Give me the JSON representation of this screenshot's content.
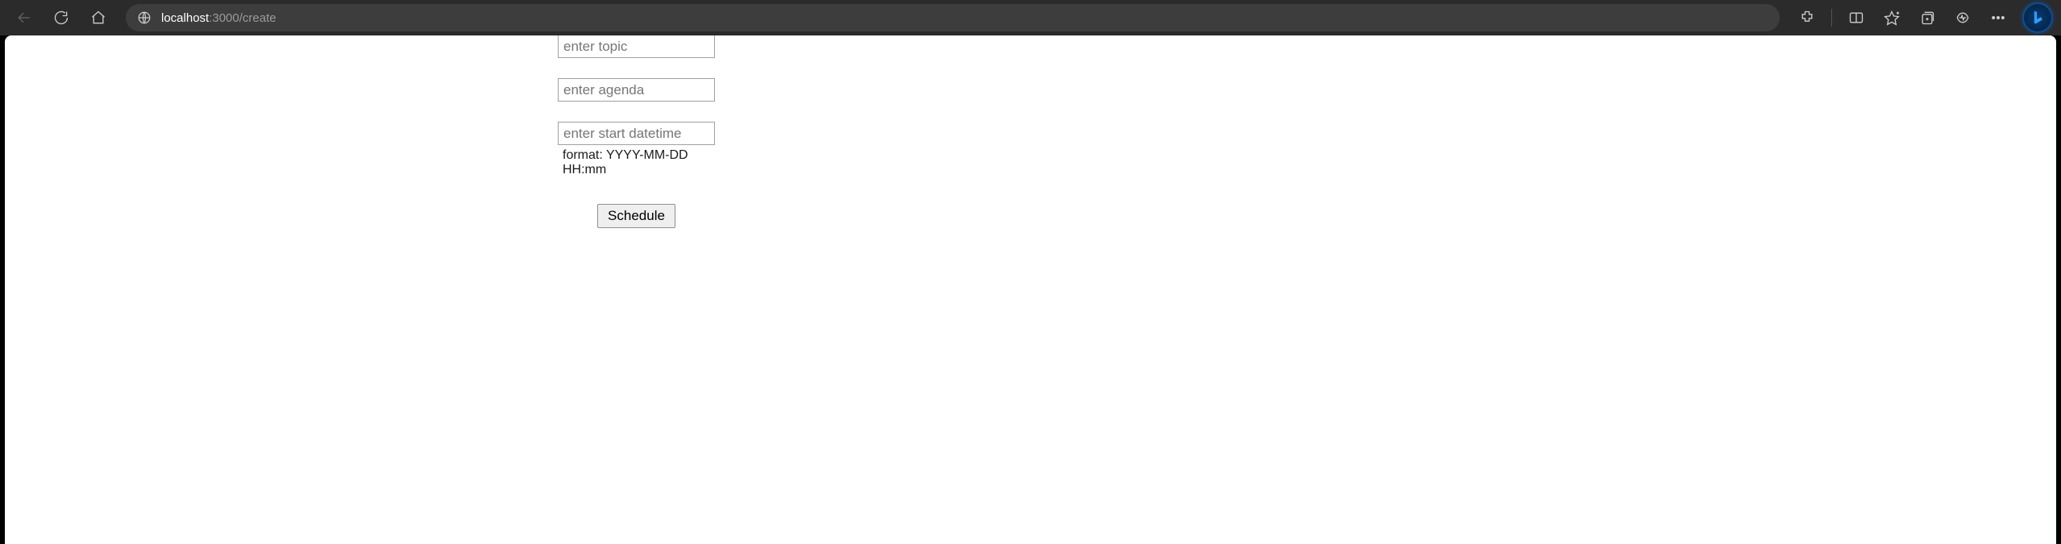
{
  "browser": {
    "url_host": "localhost",
    "url_port_path": ":3000/create"
  },
  "form": {
    "topic_value": "",
    "topic_placeholder": "enter topic",
    "agenda_value": "",
    "agenda_placeholder": "enter agenda",
    "datetime_value": "",
    "datetime_placeholder": "enter start datetime",
    "datetime_hint": "format: YYYY-MM-DD HH:mm",
    "submit_label": "Schedule"
  }
}
